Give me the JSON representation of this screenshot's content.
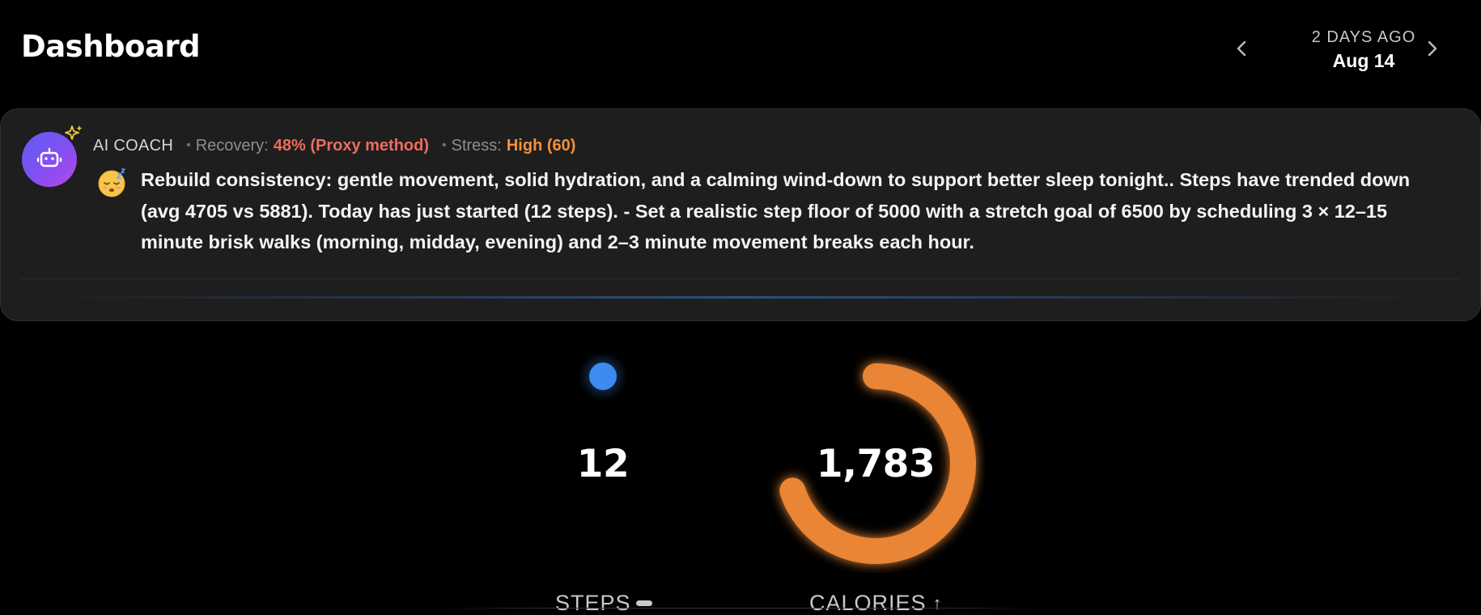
{
  "header": {
    "title": "Dashboard",
    "date_relative": "2 DAYS AGO",
    "date": "Aug 14"
  },
  "coach": {
    "label": "AI COACH",
    "recovery_label": "Recovery:",
    "recovery_value": "48% (Proxy method)",
    "stress_label": "Stress:",
    "stress_value": "High (60)",
    "message": "Rebuild consistency: gentle movement, solid hydration, and a calming wind-down to support better sleep tonight.. Steps have trended down (avg 4705 vs 5881). Today has just started (12 steps). - Set a realistic step floor of 5000 with a stretch goal of 6500 by scheduling 3 × 12–15 minute brisk walks (morning, midday, evening) and 2–3 minute movement breaks each hour.",
    "emoji_icon": "sleepy-face-emoji",
    "avatar_icon": "robot-icon",
    "accent_colors": {
      "recovery": "#ee6b5d",
      "stress": "#f39236"
    }
  },
  "metrics": {
    "steps": {
      "value": "12",
      "label": "STEPS",
      "trend": "flat",
      "progress": 0.0,
      "color": "#3d8bef"
    },
    "calories": {
      "value": "1,783",
      "label": "CALORIES",
      "trend": "up",
      "progress": 0.7,
      "color": "#e98536"
    }
  }
}
